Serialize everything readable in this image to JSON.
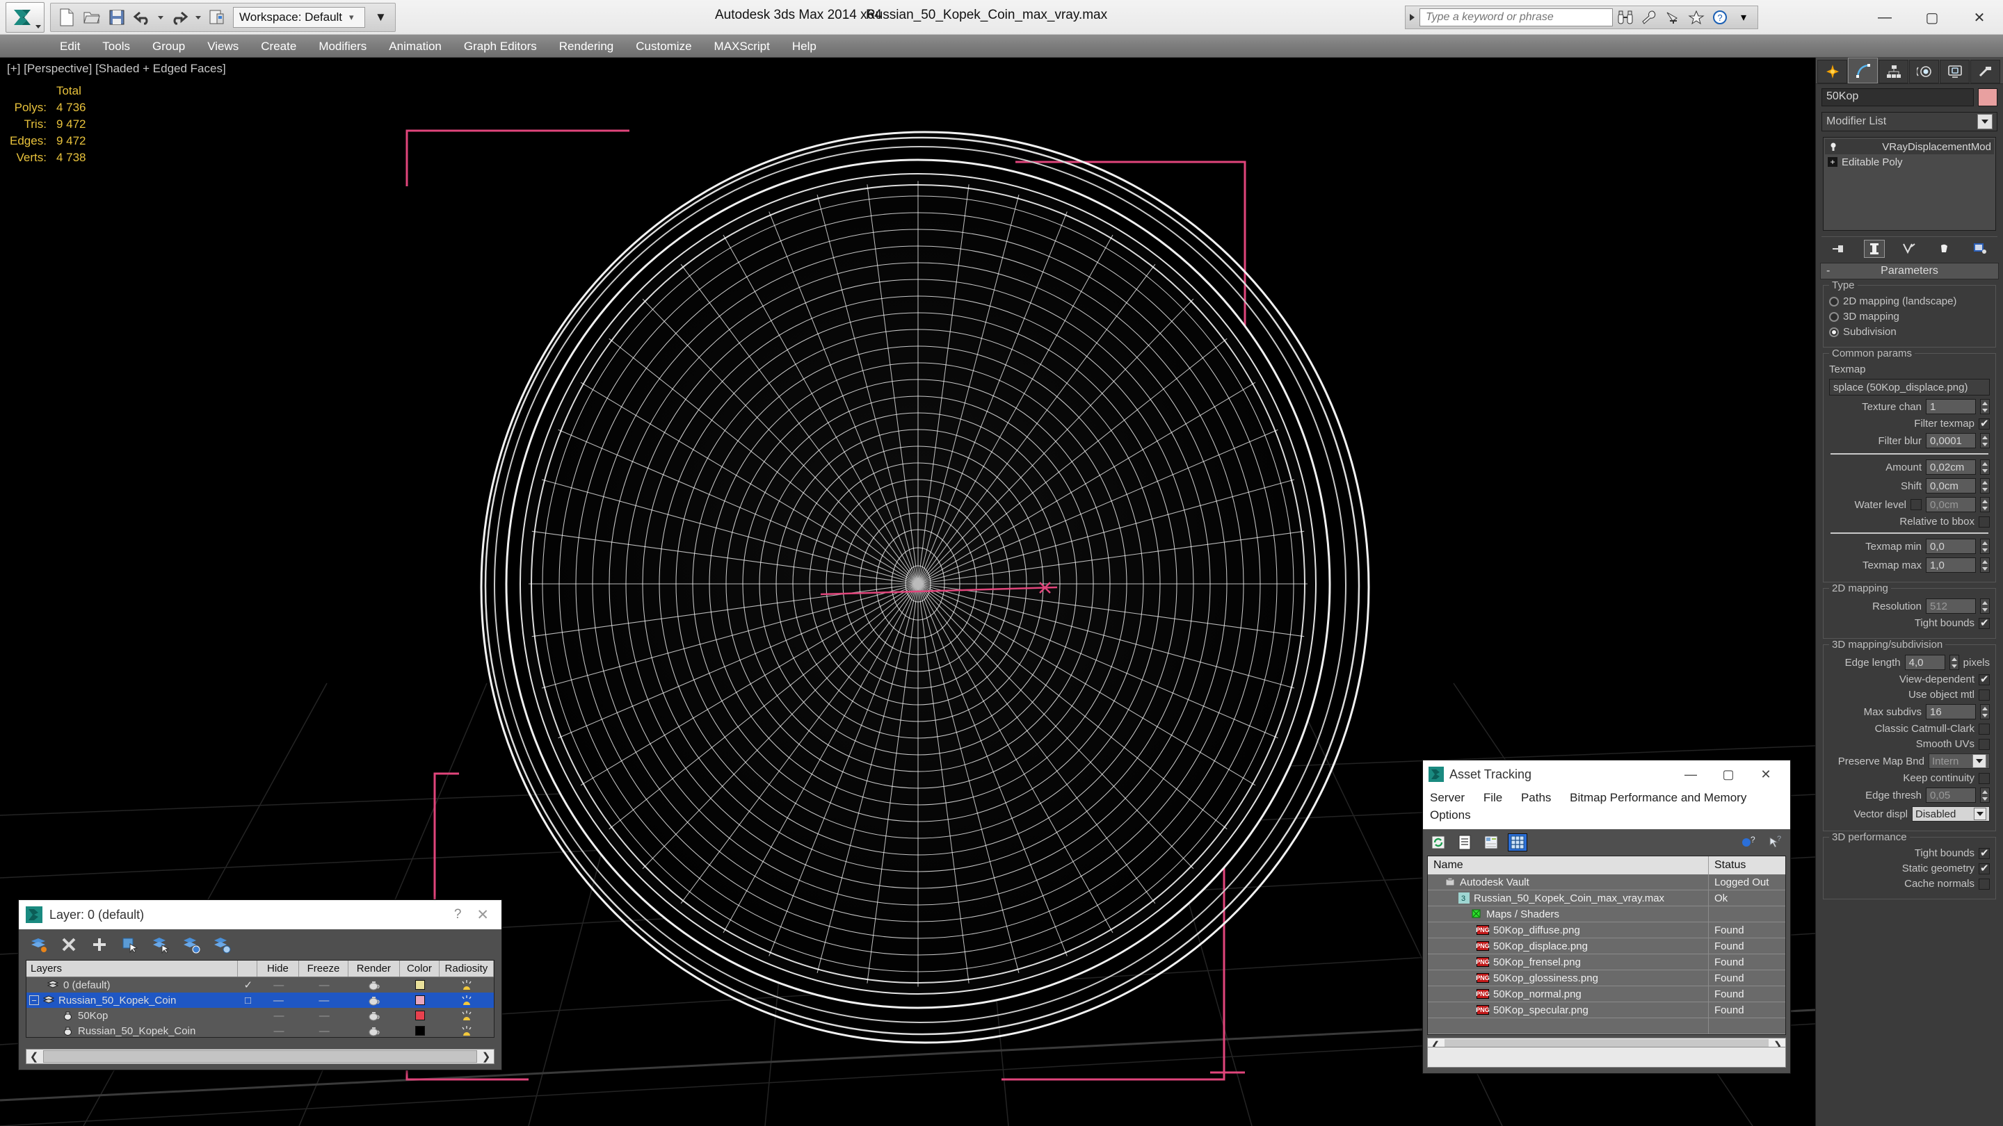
{
  "titlebar": {
    "app_title": "Autodesk 3ds Max  2014 x64",
    "file_title": "Russian_50_Kopek_Coin_max_vray.max",
    "workspace_label": "Workspace: Default",
    "search_placeholder": "Type a keyword or phrase",
    "quick_access": [
      "new-file-icon",
      "open-file-icon",
      "save-file-icon",
      "undo-icon",
      "redo-icon",
      "set-project-icon"
    ],
    "help_icons": [
      "binoculars-icon",
      "wrench-icon",
      "satellite-icon",
      "star-icon",
      "help-icon"
    ],
    "window_buttons": [
      "minimize",
      "maximize",
      "close"
    ],
    "minimize_glyph": "—",
    "maximize_glyph": "▢",
    "close_glyph": "✕"
  },
  "menubar": {
    "items": [
      "Edit",
      "Tools",
      "Group",
      "Views",
      "Create",
      "Modifiers",
      "Animation",
      "Graph Editors",
      "Rendering",
      "Customize",
      "MAXScript",
      "Help"
    ]
  },
  "viewport": {
    "label": "[+] [Perspective] [Shaded + Edged Faces]",
    "stats_header": "Total",
    "stats": [
      {
        "label": "Polys:",
        "value": "4 736"
      },
      {
        "label": "Tris:",
        "value": "9 472"
      },
      {
        "label": "Edges:",
        "value": "9 472"
      },
      {
        "label": "Verts:",
        "value": "4 738"
      }
    ]
  },
  "command_panel": {
    "tabs": [
      "create-tab",
      "modify-tab",
      "hierarchy-tab",
      "motion-tab",
      "display-tab",
      "utilities-tab"
    ],
    "selected_tab": "modify-tab",
    "object_name": "50Kop",
    "object_color": "#e8a0a0",
    "modifier_list_label": "Modifier List",
    "stack": [
      {
        "label": "VRayDisplacementMod",
        "icon": "light-bulb-icon"
      },
      {
        "label": "Editable Poly",
        "icon": "plus-box-icon"
      }
    ],
    "stack_buttons": [
      "pin-stack-icon",
      "show-end-result-icon",
      "make-unique-icon",
      "remove-modifier-icon",
      "configure-sets-icon"
    ],
    "rollout": {
      "title": "Parameters",
      "collapse_glyph": "-",
      "type_group": {
        "label": "Type",
        "options": [
          {
            "label": "2D mapping (landscape)",
            "selected": false
          },
          {
            "label": "3D mapping",
            "selected": false
          },
          {
            "label": "Subdivision",
            "selected": true
          }
        ]
      },
      "common_params": {
        "label": "Common params",
        "texmap_label": "Texmap",
        "texmap_value": "splace (50Kop_displace.png)",
        "fields": [
          {
            "label": "Texture chan",
            "value": "1",
            "type": "spinner"
          },
          {
            "label": "Filter texmap",
            "value": "",
            "type": "checkbox",
            "checked": true
          },
          {
            "label": "Filter blur",
            "value": "0,0001",
            "type": "spinner"
          },
          {
            "label": "Amount",
            "value": "0,02cm",
            "type": "spinner"
          },
          {
            "label": "Shift",
            "value": "0,0cm",
            "type": "spinner"
          },
          {
            "label": "Water level",
            "value": "0,0cm",
            "type": "spinner-check",
            "checked": false
          },
          {
            "label": "Relative to bbox",
            "value": "",
            "type": "checkbox",
            "checked": false
          },
          {
            "label": "Texmap min",
            "value": "0,0",
            "type": "spinner"
          },
          {
            "label": "Texmap max",
            "value": "1,0",
            "type": "spinner"
          }
        ]
      },
      "mapping_2d": {
        "label": "2D mapping",
        "fields": [
          {
            "label": "Resolution",
            "value": "512",
            "type": "spinner"
          },
          {
            "label": "Tight bounds",
            "value": "",
            "type": "checkbox",
            "checked": true
          }
        ]
      },
      "mapping_3d": {
        "label": "3D mapping/subdivision",
        "fields": [
          {
            "label": "Edge length",
            "value": "4,0",
            "type": "spinner",
            "suffix": "pixels"
          },
          {
            "label": "View-dependent",
            "value": "",
            "type": "checkbox",
            "checked": true
          },
          {
            "label": "Use object mtl",
            "value": "",
            "type": "checkbox",
            "checked": false
          },
          {
            "label": "Max subdivs",
            "value": "16",
            "type": "spinner"
          },
          {
            "label": "Classic Catmull-Clark",
            "value": "",
            "type": "checkbox",
            "checked": false
          },
          {
            "label": "Smooth UVs",
            "value": "",
            "type": "checkbox",
            "checked": false
          },
          {
            "label": "Preserve Map Bnd",
            "value": "Intern",
            "type": "dropdown-gray"
          },
          {
            "label": "Keep continuity",
            "value": "",
            "type": "checkbox",
            "checked": false
          },
          {
            "label": "Edge thresh",
            "value": "0,05",
            "type": "spinner"
          },
          {
            "label": "Vector displ",
            "value": "Disabled",
            "type": "dropdown"
          }
        ]
      },
      "performance_3d": {
        "label": "3D performance",
        "fields": [
          {
            "label": "Tight bounds",
            "value": "",
            "type": "checkbox",
            "checked": true
          },
          {
            "label": "Static geometry",
            "value": "",
            "type": "checkbox",
            "checked": true
          },
          {
            "label": "Cache normals",
            "value": "",
            "type": "checkbox",
            "checked": false
          }
        ]
      }
    }
  },
  "layer_dialog": {
    "title": "Layer: 0 (default)",
    "help_glyph": "?",
    "close_glyph": "✕",
    "toolbar": [
      "create-new-layer-icon",
      "delete-layer-icon",
      "add-to-layer-icon",
      "select-objects-icon",
      "select-highlighted-icon",
      "highlight-selected-icon",
      "layer-properties-icon"
    ],
    "columns": [
      "Layers",
      "",
      "Hide",
      "Freeze",
      "Render",
      "Color",
      "Radiosity"
    ],
    "rows": [
      {
        "name": "0 (default)",
        "indent": 1,
        "icon": "layer-icon",
        "active": "✓",
        "hide": "—",
        "freeze": "—",
        "render": "teapot-icon",
        "color": "#e9e09a",
        "radiosity": "light-icon",
        "selected": false,
        "expander": ""
      },
      {
        "name": "Russian_50_Kopek_Coin",
        "indent": 0,
        "icon": "layer-icon",
        "active": "□",
        "hide": "—",
        "freeze": "—",
        "render": "teapot-icon",
        "color": "#e7a6bf",
        "radiosity": "light-icon",
        "selected": true,
        "expander": "−"
      },
      {
        "name": "50Kop",
        "indent": 2,
        "icon": "object-icon",
        "active": "",
        "hide": "—",
        "freeze": "—",
        "render": "teapot-icon",
        "color": "#e8414e",
        "radiosity": "light-icon",
        "selected": false,
        "expander": ""
      },
      {
        "name": "Russian_50_Kopek_Coin",
        "indent": 2,
        "icon": "object-icon",
        "active": "",
        "hide": "—",
        "freeze": "—",
        "render": "teapot-icon",
        "color": "#000000",
        "radiosity": "light-icon",
        "selected": false,
        "expander": ""
      }
    ],
    "scroll_left_glyph": "❮",
    "scroll_right_glyph": "❯"
  },
  "asset_tracking": {
    "title": "Asset Tracking",
    "minimize_glyph": "—",
    "maximize_glyph": "▢",
    "close_glyph": "✕",
    "menu": [
      "Server",
      "File",
      "Paths",
      "Bitmap Performance and Memory",
      "Options"
    ],
    "toolbar": [
      "refresh-icon",
      "list-view-icon",
      "detail-view-icon",
      "grid-view-icon"
    ],
    "toolbar_right": [
      "add-help-icon",
      "help-query-icon"
    ],
    "selected_toolbar": "grid-view-icon",
    "columns": [
      "Name",
      "Status"
    ],
    "rows": [
      {
        "name": "Autodesk Vault",
        "status": "Logged Out",
        "indent": 0,
        "icon": "vault-icon"
      },
      {
        "name": "Russian_50_Kopek_Coin_max_vray.max",
        "status": "Ok",
        "indent": 1,
        "icon": "max-file-icon"
      },
      {
        "name": "Maps / Shaders",
        "status": "",
        "indent": 1,
        "icon": "maps-icon"
      },
      {
        "name": "50Kop_diffuse.png",
        "status": "Found",
        "indent": 2,
        "icon": "png-icon"
      },
      {
        "name": "50Kop_displace.png",
        "status": "Found",
        "indent": 2,
        "icon": "png-icon"
      },
      {
        "name": "50Kop_frensel.png",
        "status": "Found",
        "indent": 2,
        "icon": "png-icon"
      },
      {
        "name": "50Kop_glossiness.png",
        "status": "Found",
        "indent": 2,
        "icon": "png-icon"
      },
      {
        "name": "50Kop_normal.png",
        "status": "Found",
        "indent": 2,
        "icon": "png-icon"
      },
      {
        "name": "50Kop_specular.png",
        "status": "Found",
        "indent": 2,
        "icon": "png-icon"
      }
    ],
    "scroll_left_glyph": "❮",
    "scroll_right_glyph": "❯"
  }
}
